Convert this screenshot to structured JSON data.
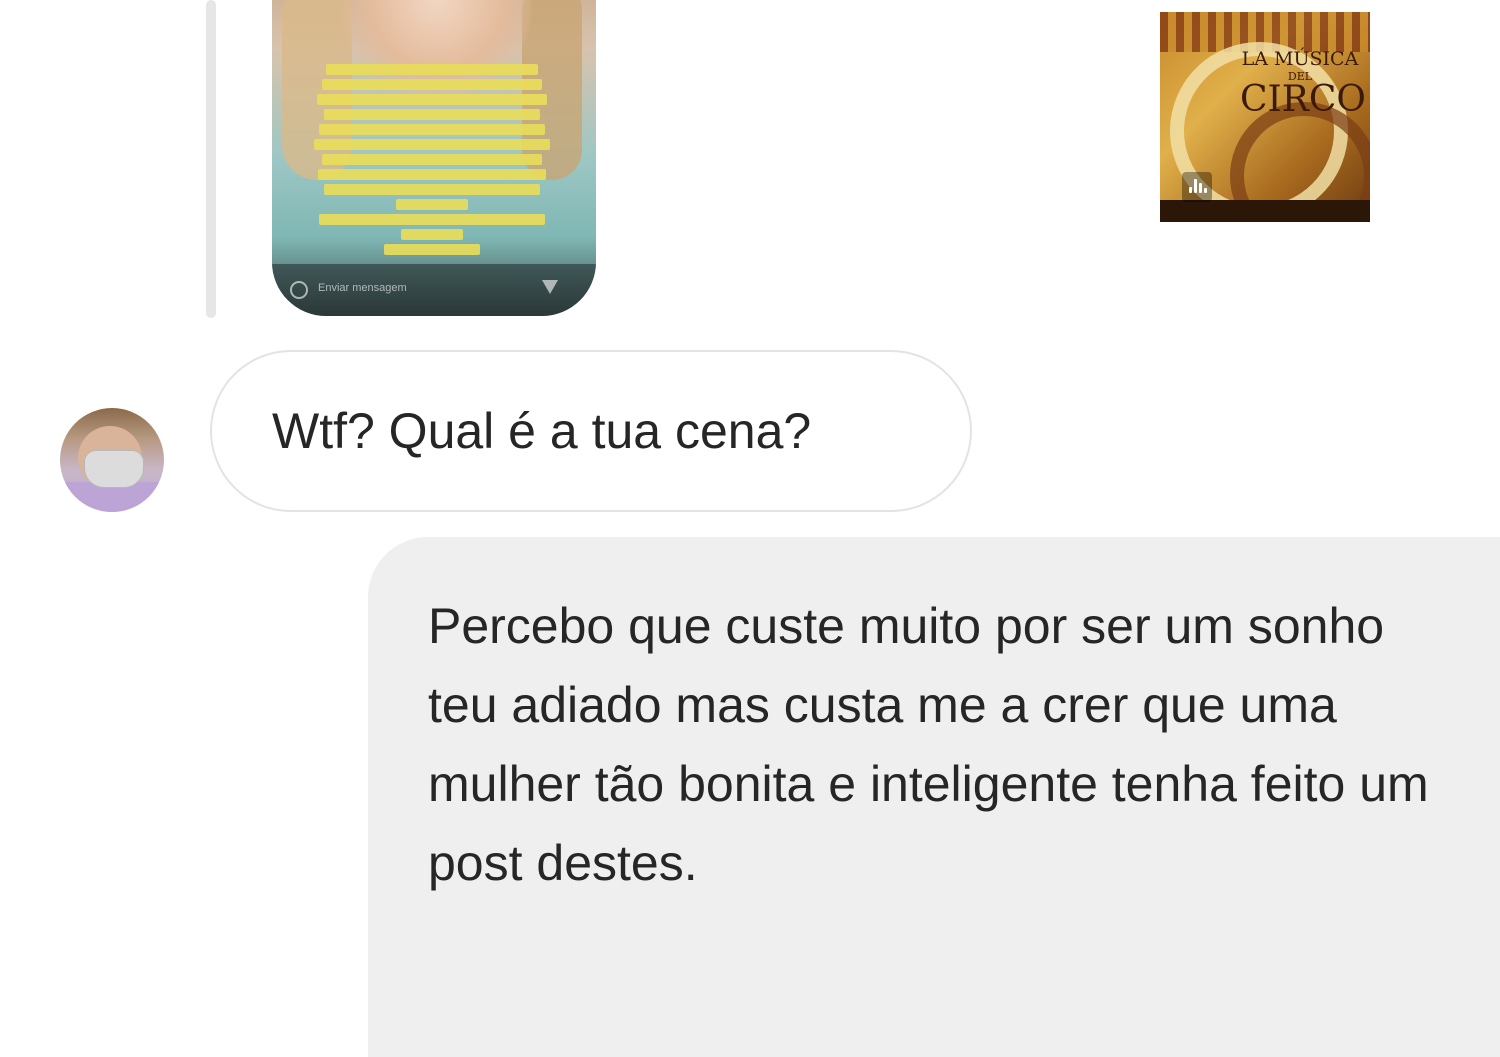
{
  "story_reply": {
    "placeholder": "Enviar mensagem"
  },
  "album": {
    "title_line1": "LA MÚSICA",
    "title_line2": "DEL",
    "title_line3": "CIRCO",
    "icon": "audio-waveform-icon"
  },
  "messages": [
    {
      "sender": "other",
      "text": "Wtf? Qual é a tua cena?"
    },
    {
      "sender": "me",
      "text": "Percebo que custe muito por ser um sonho teu adiado mas custa me a crer que uma mulher tão bonita e inteligente tenha feito um post destes."
    }
  ],
  "colors": {
    "incoming_border": "#e3e3e3",
    "outgoing_bg": "#efefef",
    "text": "#262626"
  }
}
